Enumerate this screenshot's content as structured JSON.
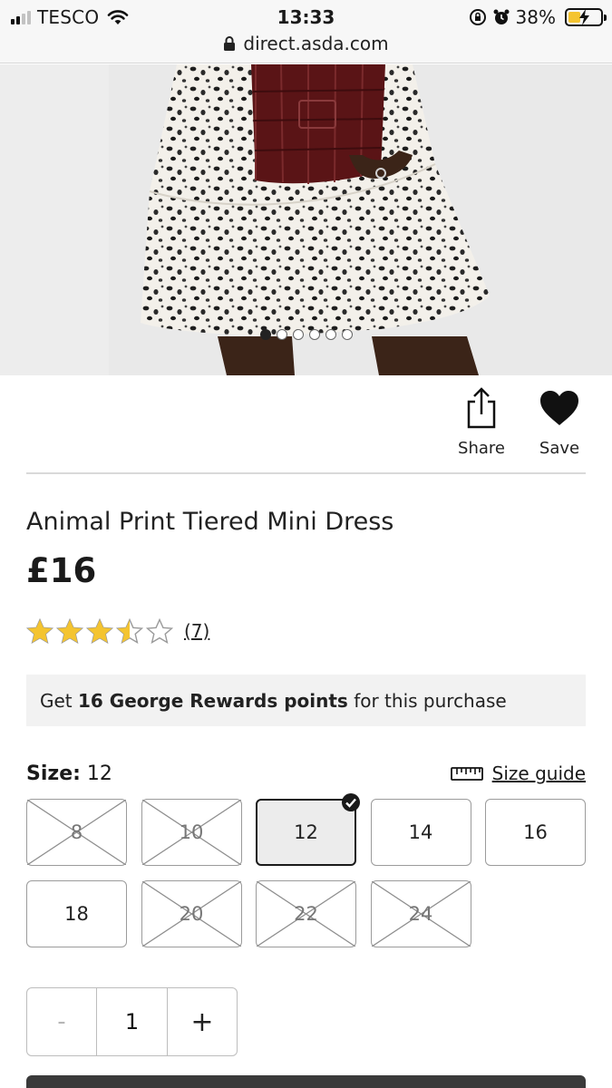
{
  "status_bar": {
    "carrier": "TESCO",
    "time": "13:33",
    "battery_percent": "38%",
    "battery_level": 0.38
  },
  "address_bar": {
    "url": "direct.asda.com"
  },
  "gallery": {
    "image_count": 6,
    "active_index": 0
  },
  "actions": {
    "share_label": "Share",
    "save_label": "Save"
  },
  "product": {
    "title": "Animal Print Tiered Mini Dress",
    "price": "£16",
    "rating": 3.5,
    "rating_max": 5,
    "review_count": "(7)"
  },
  "rewards": {
    "prefix": "Get ",
    "highlight": "16 George Rewards points",
    "suffix": " for this purchase"
  },
  "size_selector": {
    "label": "Size:",
    "selected": "12",
    "guide_label": "Size guide",
    "options": [
      {
        "label": "8",
        "available": false
      },
      {
        "label": "10",
        "available": false
      },
      {
        "label": "12",
        "available": true,
        "selected": true
      },
      {
        "label": "14",
        "available": true
      },
      {
        "label": "16",
        "available": true
      },
      {
        "label": "18",
        "available": true
      },
      {
        "label": "20",
        "available": false
      },
      {
        "label": "22",
        "available": false
      },
      {
        "label": "24",
        "available": false
      }
    ]
  },
  "quantity": {
    "minus": "-",
    "value": "1",
    "plus": "+"
  },
  "colors": {
    "star": "#f4c430",
    "dark": "#1a1a1a",
    "battery": "#f4c430"
  }
}
